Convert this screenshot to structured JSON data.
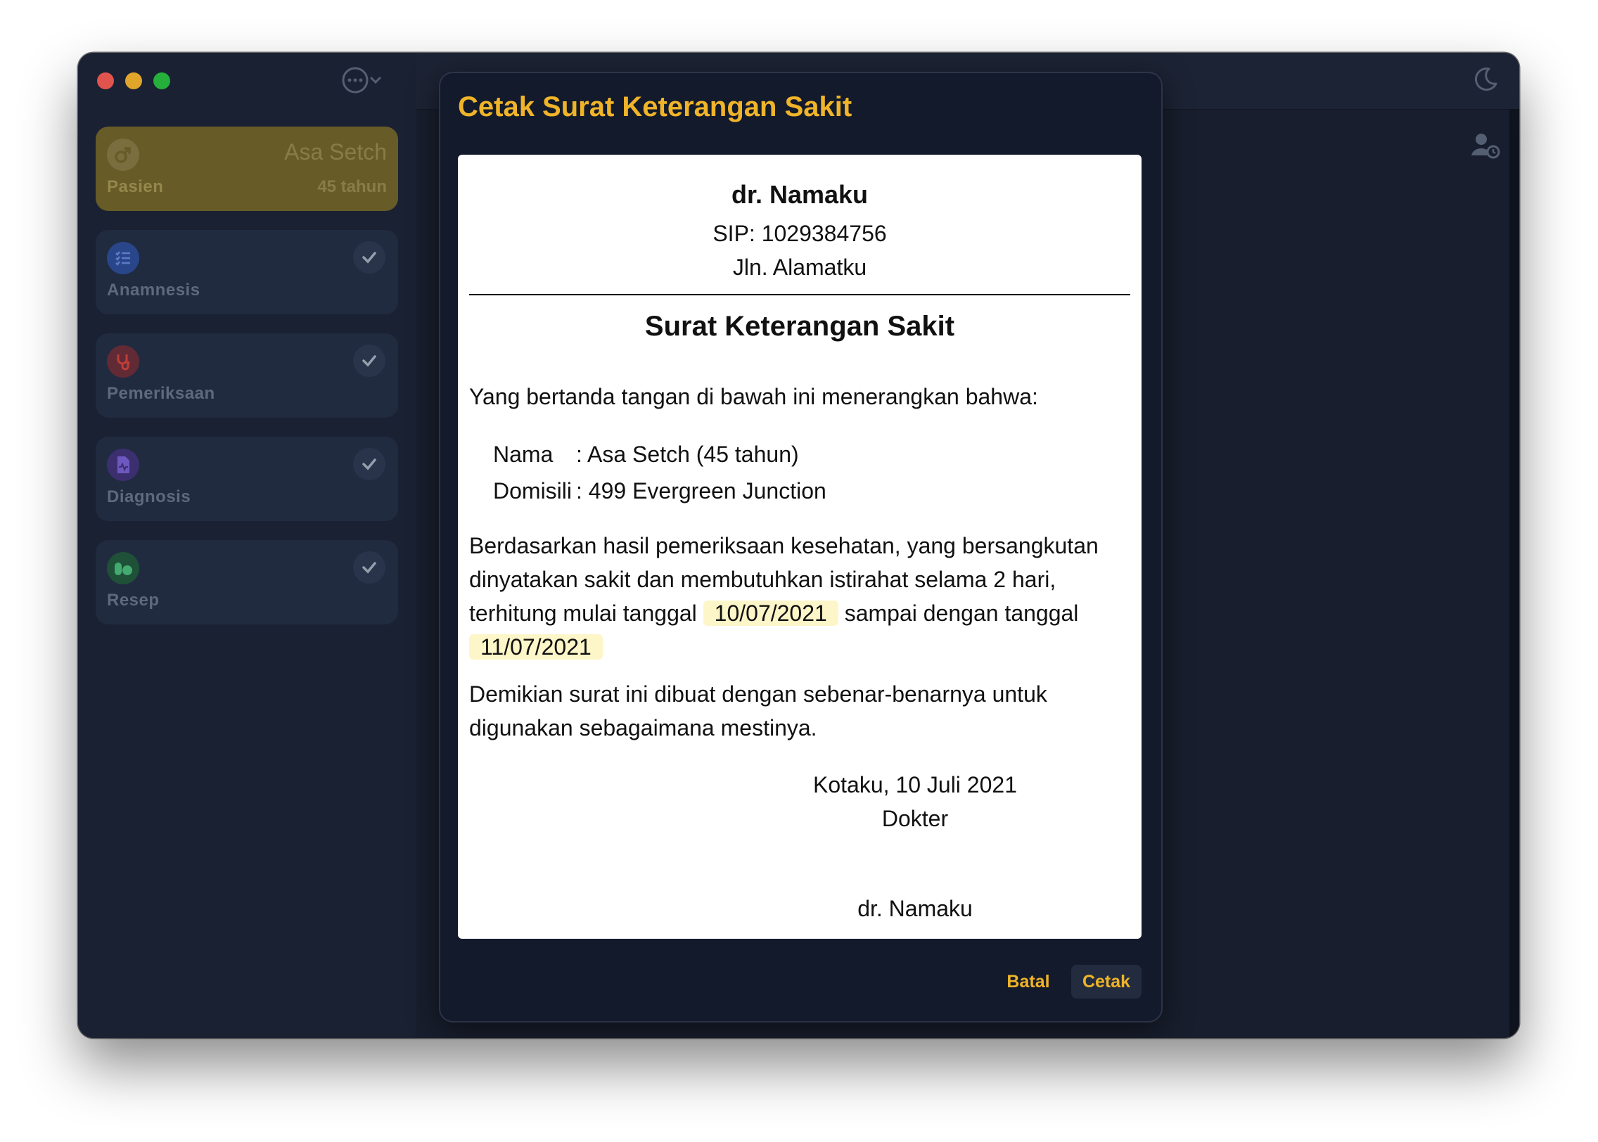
{
  "sidebar": {
    "patient_card": {
      "label": "Pasien",
      "name": "Asa Setch",
      "age": "45 tahun"
    },
    "items": [
      {
        "label": "Anamnesis",
        "icon": "checklist-icon",
        "color": "#3b6fe0",
        "completed": true
      },
      {
        "label": "Pemeriksaan",
        "icon": "stethoscope-icon",
        "color": "#d9463e",
        "completed": true
      },
      {
        "label": "Diagnosis",
        "icon": "medical-file-icon",
        "color": "#6a4fd1",
        "completed": true
      },
      {
        "label": "Resep",
        "icon": "pills-icon",
        "color": "#2f9e5b",
        "completed": true
      }
    ]
  },
  "dialog": {
    "title": "Cetak Surat Keterangan Sakit",
    "doctor_name": "dr. Namaku",
    "sip": "SIP: 1029384756",
    "address": "Jln. Alamatku",
    "letter_title": "Surat Keterangan Sakit",
    "intro": "Yang bertanda tangan di bawah ini menerangkan bahwa:",
    "fields": {
      "nama_label": "Nama",
      "nama_value": ": Asa Setch (45 tahun)",
      "domisili_label": "Domisili",
      "domisili_value": ": 499 Evergreen Junction"
    },
    "body_part1": "Berdasarkan hasil pemeriksaan kesehatan, yang bersangkutan dinyatakan sakit dan membutuhkan istirahat selama 2 hari, terhitung mulai tanggal",
    "start_date": "10/07/2021",
    "body_part2": "sampai dengan tanggal",
    "end_date": "11/07/2021",
    "closing": "Demikian surat ini dibuat dengan sebenar-benarnya untuk digunakan sebagaimana mestinya.",
    "place_date": "Kotaku, 10 Juli 2021",
    "signer_role": "Dokter",
    "signer_name": "dr. Namaku",
    "cancel_label": "Batal",
    "print_label": "Cetak"
  },
  "colors": {
    "accent": "#f0b429",
    "highlight": "#fdf6c8",
    "background": "#1b2232"
  }
}
